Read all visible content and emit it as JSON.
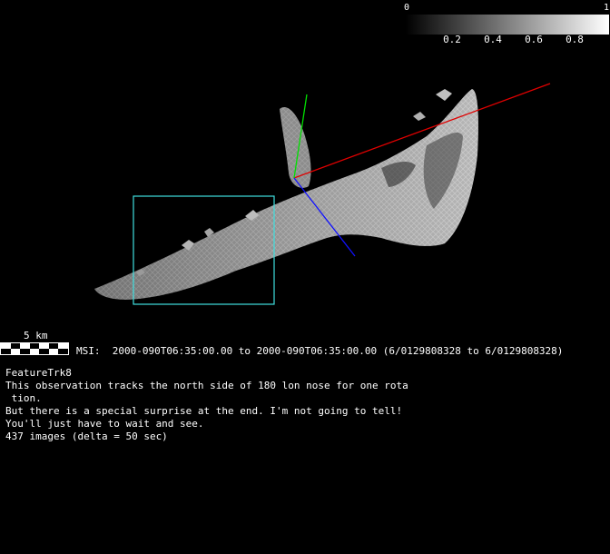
{
  "colorbar": {
    "min_label": "0",
    "max_label": "1",
    "tick_labels": [
      "0.2",
      "0.4",
      "0.6",
      "0.8"
    ]
  },
  "scale": {
    "label": "5 km"
  },
  "msi_line": "MSI:  2000-090T06:35:00.00 to 2000-090T06:35:00.00 (6/0129808328 to 6/0129808328)",
  "info": {
    "title": "FeatureTrk8",
    "lines": [
      "This observation tracks the north side of 180 lon nose for one rota",
      " tion.",
      "But there is a special surprise at the end. I'm not going to tell!",
      "You'll just have to wait and see.",
      "437 images (delta = 50 sec)"
    ]
  },
  "colors": {
    "x_axis": "#e00000",
    "y_axis": "#00e000",
    "z_axis": "#1010ff",
    "frame_box": "#3fe0e0",
    "shape": "#9a9a9a"
  }
}
